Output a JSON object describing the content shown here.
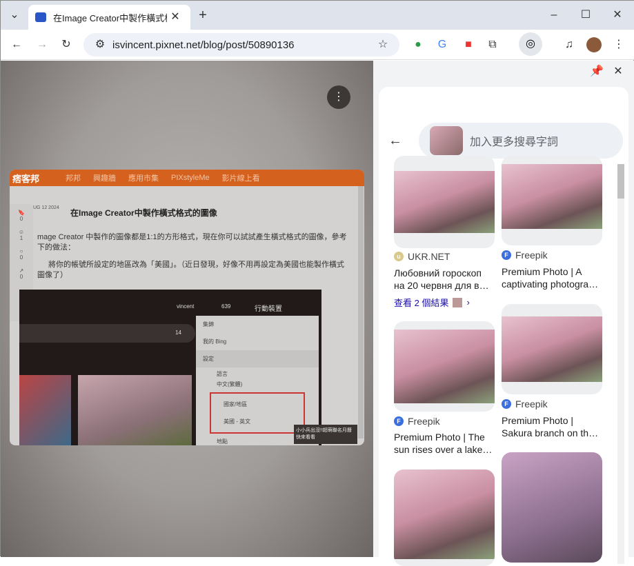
{
  "browser": {
    "tab_title": "在Image Creator中製作橫式格式",
    "url": "isvincent.pixnet.net/blog/post/50890136"
  },
  "page": {
    "nav": [
      "邦邦",
      "興趣牆",
      "應用市集",
      "PIXstyleMe",
      "影片線上看"
    ],
    "logo": "痞客邦",
    "date": "UG 12 2024",
    "title": "在Image Creator中製作橫式格式的圖像",
    "para1": "mage Creator 中製作的圖像都是1:1的方形格式，現在你可以試試產生橫式格式的圖像，參考",
    "para1b": "下的做法：",
    "para2": "將你的帳號所設定的地區改為「美國」。（近日發現，好像不用再設定為美國也能製作橫式",
    "para2b": "圖像了）",
    "side_counts": [
      "0",
      "1",
      "0",
      "0"
    ],
    "inner": {
      "user": "vincent",
      "points": "639",
      "device": "行動裝置",
      "coins": "14",
      "menu": [
        "集錦",
        "我的 Bing",
        "設定",
        "語言",
        "中文(繁體)",
        "國家/地區",
        "美國 - 英文",
        "地點"
      ],
      "ad": "小小兵出沒!!超萌聯名月曆快來看看"
    }
  },
  "lens": {
    "search_placeholder": "加入更多搜尋字詞",
    "results": [
      {
        "source": "UKR.NET",
        "title1": "Любовний гороскоп",
        "title2": "на 20 червня для в…",
        "more": "查看 2 個結果"
      },
      {
        "source": "Freepik",
        "title1": "Premium Photo | A",
        "title2": "captivating photogra…"
      },
      {
        "source": "Freepik",
        "title1": "Premium Photo | The",
        "title2": "sun rises over a lake…"
      },
      {
        "source": "Freepik",
        "title1": "Premium Photo |",
        "title2": "Sakura branch on th…"
      }
    ]
  }
}
